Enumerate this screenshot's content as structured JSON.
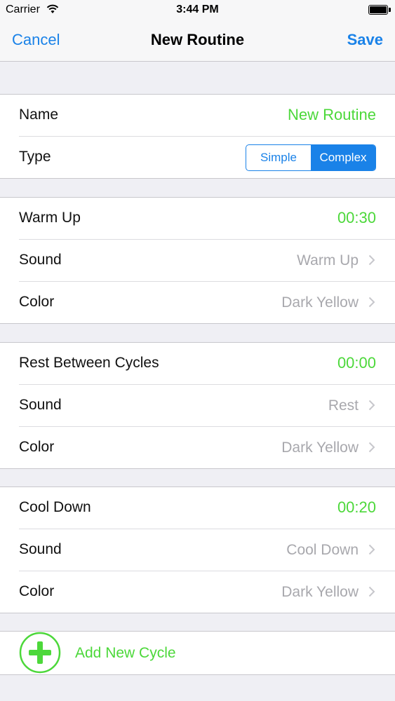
{
  "status_bar": {
    "carrier": "Carrier",
    "time": "3:44 PM"
  },
  "nav": {
    "cancel": "Cancel",
    "title": "New Routine",
    "save": "Save"
  },
  "general": {
    "name_label": "Name",
    "name_value": "New Routine",
    "type_label": "Type",
    "type_options": [
      "Simple",
      "Complex"
    ],
    "type_selected": "Complex"
  },
  "warm_up": {
    "label": "Warm Up",
    "time": "00:30",
    "sound_label": "Sound",
    "sound_value": "Warm Up",
    "color_label": "Color",
    "color_value": "Dark Yellow"
  },
  "rest": {
    "label": "Rest Between Cycles",
    "time": "00:00",
    "sound_label": "Sound",
    "sound_value": "Rest",
    "color_label": "Color",
    "color_value": "Dark Yellow"
  },
  "cool_down": {
    "label": "Cool Down",
    "time": "00:20",
    "sound_label": "Sound",
    "sound_value": "Cool Down",
    "color_label": "Color",
    "color_value": "Dark Yellow"
  },
  "add_cycle": {
    "label": "Add New Cycle",
    "icon": "plus-circle-icon"
  },
  "colors": {
    "accent_blue": "#1a82e8",
    "accent_green": "#4cd83a",
    "background": "#efeff4"
  }
}
